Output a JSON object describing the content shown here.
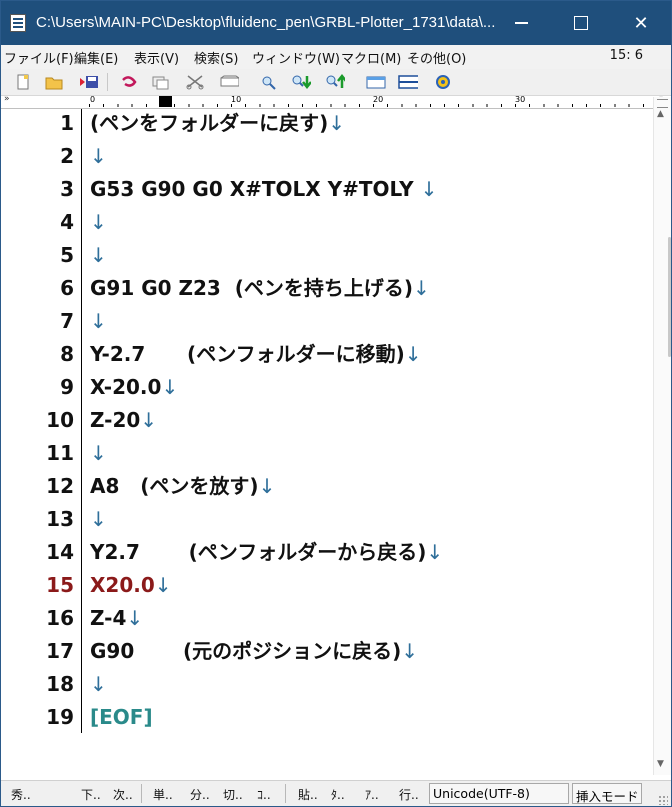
{
  "window": {
    "title": "C:\\Users\\MAIN-PC\\Desktop\\fluidenc_pen\\GRBL-Plotter_1731\\data\\...",
    "minimize_glyph": "",
    "close_glyph": "✕"
  },
  "menu": {
    "items": [
      {
        "label": "ファイル(F)"
      },
      {
        "label": "編集(E)"
      },
      {
        "label": "表示(V)"
      },
      {
        "label": "検索(S)"
      },
      {
        "label": "ウィンドウ(W)"
      },
      {
        "label": "マクロ(M)"
      },
      {
        "label": "その他(O)"
      }
    ],
    "cursor_position": "15: 6"
  },
  "toolbar": {
    "icons": [
      "new-file-icon",
      "open-folder-icon",
      "save-icon",
      "undo-icon",
      "copy-icon",
      "cut-icon",
      "paste-icon",
      "find-icon",
      "find-next-icon",
      "find-prev-icon",
      "grep-icon",
      "split-view-icon",
      "macro-icon"
    ]
  },
  "ruler": {
    "labels": [
      "0",
      "10",
      "20",
      "30"
    ]
  },
  "editor": {
    "eol_mark": "↓",
    "lines": [
      {
        "num": "1",
        "text": "(ペンをフォルダーに戻す)"
      },
      {
        "num": "2",
        "text": ""
      },
      {
        "num": "3",
        "text": "G53 G90 G0 X#TOLX Y#TOLY "
      },
      {
        "num": "4",
        "text": ""
      },
      {
        "num": "5",
        "text": ""
      },
      {
        "num": "6",
        "text": "G91 G0 Z23  (ペンを持ち上げる)"
      },
      {
        "num": "7",
        "text": ""
      },
      {
        "num": "8",
        "text": "Y-2.7      (ペンフォルダーに移動)"
      },
      {
        "num": "9",
        "text": "X-20.0"
      },
      {
        "num": "10",
        "text": "Z-20"
      },
      {
        "num": "11",
        "text": ""
      },
      {
        "num": "12",
        "text": "A8   (ペンを放す)"
      },
      {
        "num": "13",
        "text": ""
      },
      {
        "num": "14",
        "text": "Y2.7       (ペンフォルダーから戻る)"
      },
      {
        "num": "15",
        "text": "X20.0",
        "active": true
      },
      {
        "num": "16",
        "text": "Z-4"
      },
      {
        "num": "17",
        "text": "G90       (元のポジションに戻る)"
      },
      {
        "num": "18",
        "text": ""
      },
      {
        "num": "19",
        "text": "[EOF]",
        "eof": true
      }
    ]
  },
  "statusbar": {
    "items": [
      "秀..",
      "下..",
      "次..",
      "単..",
      "分..",
      "切..",
      "ｺ..",
      "貼..",
      "ﾀ..",
      "ｱ..",
      "行.."
    ],
    "encoding": "Unicode(UTF-8)",
    "mode": "挿入モード"
  }
}
